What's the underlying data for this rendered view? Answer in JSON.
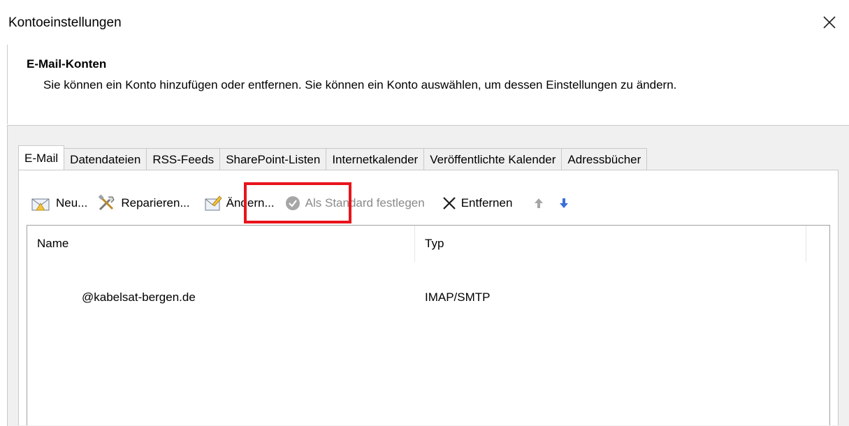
{
  "window": {
    "title": "Kontoeinstellungen",
    "close_icon": "close-icon"
  },
  "header": {
    "title": "E-Mail-Konten",
    "description": "Sie können ein Konto hinzufügen oder entfernen. Sie können ein Konto auswählen, um dessen Einstellungen zu ändern."
  },
  "tabs": [
    {
      "label": "E-Mail",
      "active": true
    },
    {
      "label": "Datendateien"
    },
    {
      "label": "RSS-Feeds"
    },
    {
      "label": "SharePoint-Listen"
    },
    {
      "label": "Internetkalender"
    },
    {
      "label": "Veröffentlichte Kalender"
    },
    {
      "label": "Adressbücher"
    }
  ],
  "toolbar": {
    "new_label": "Neu...",
    "repair_label": "Reparieren...",
    "change_label": "Ändern...",
    "set_default_label": "Als Standard festlegen",
    "remove_label": "Entfernen"
  },
  "list": {
    "columns": [
      "Name",
      "Typ"
    ],
    "rows": [
      {
        "name": "@kabelsat-bergen.de",
        "type": "IMAP/SMTP"
      }
    ]
  },
  "colors": {
    "highlight": "#e8141c",
    "accent": "#3c6fd8"
  }
}
